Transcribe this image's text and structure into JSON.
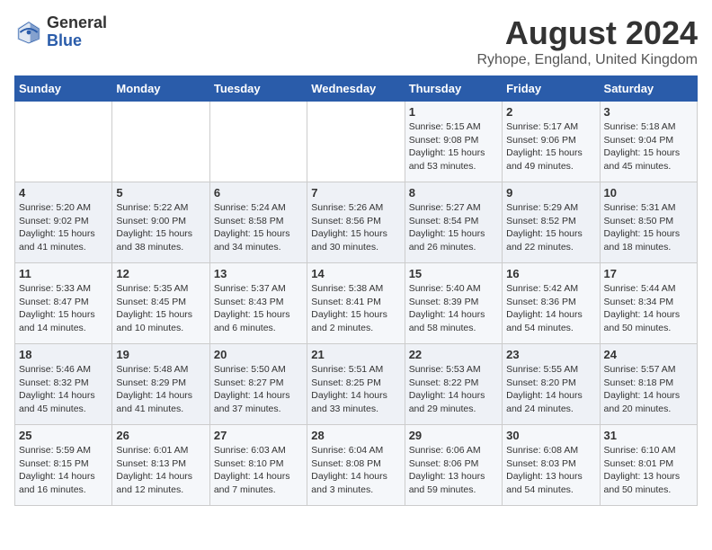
{
  "header": {
    "logo_line1": "General",
    "logo_line2": "Blue",
    "title": "August 2024",
    "subtitle": "Ryhope, England, United Kingdom"
  },
  "weekdays": [
    "Sunday",
    "Monday",
    "Tuesday",
    "Wednesday",
    "Thursday",
    "Friday",
    "Saturday"
  ],
  "weeks": [
    [
      {
        "day": "",
        "info": ""
      },
      {
        "day": "",
        "info": ""
      },
      {
        "day": "",
        "info": ""
      },
      {
        "day": "",
        "info": ""
      },
      {
        "day": "1",
        "info": "Sunrise: 5:15 AM\nSunset: 9:08 PM\nDaylight: 15 hours\nand 53 minutes."
      },
      {
        "day": "2",
        "info": "Sunrise: 5:17 AM\nSunset: 9:06 PM\nDaylight: 15 hours\nand 49 minutes."
      },
      {
        "day": "3",
        "info": "Sunrise: 5:18 AM\nSunset: 9:04 PM\nDaylight: 15 hours\nand 45 minutes."
      }
    ],
    [
      {
        "day": "4",
        "info": "Sunrise: 5:20 AM\nSunset: 9:02 PM\nDaylight: 15 hours\nand 41 minutes."
      },
      {
        "day": "5",
        "info": "Sunrise: 5:22 AM\nSunset: 9:00 PM\nDaylight: 15 hours\nand 38 minutes."
      },
      {
        "day": "6",
        "info": "Sunrise: 5:24 AM\nSunset: 8:58 PM\nDaylight: 15 hours\nand 34 minutes."
      },
      {
        "day": "7",
        "info": "Sunrise: 5:26 AM\nSunset: 8:56 PM\nDaylight: 15 hours\nand 30 minutes."
      },
      {
        "day": "8",
        "info": "Sunrise: 5:27 AM\nSunset: 8:54 PM\nDaylight: 15 hours\nand 26 minutes."
      },
      {
        "day": "9",
        "info": "Sunrise: 5:29 AM\nSunset: 8:52 PM\nDaylight: 15 hours\nand 22 minutes."
      },
      {
        "day": "10",
        "info": "Sunrise: 5:31 AM\nSunset: 8:50 PM\nDaylight: 15 hours\nand 18 minutes."
      }
    ],
    [
      {
        "day": "11",
        "info": "Sunrise: 5:33 AM\nSunset: 8:47 PM\nDaylight: 15 hours\nand 14 minutes."
      },
      {
        "day": "12",
        "info": "Sunrise: 5:35 AM\nSunset: 8:45 PM\nDaylight: 15 hours\nand 10 minutes."
      },
      {
        "day": "13",
        "info": "Sunrise: 5:37 AM\nSunset: 8:43 PM\nDaylight: 15 hours\nand 6 minutes."
      },
      {
        "day": "14",
        "info": "Sunrise: 5:38 AM\nSunset: 8:41 PM\nDaylight: 15 hours\nand 2 minutes."
      },
      {
        "day": "15",
        "info": "Sunrise: 5:40 AM\nSunset: 8:39 PM\nDaylight: 14 hours\nand 58 minutes."
      },
      {
        "day": "16",
        "info": "Sunrise: 5:42 AM\nSunset: 8:36 PM\nDaylight: 14 hours\nand 54 minutes."
      },
      {
        "day": "17",
        "info": "Sunrise: 5:44 AM\nSunset: 8:34 PM\nDaylight: 14 hours\nand 50 minutes."
      }
    ],
    [
      {
        "day": "18",
        "info": "Sunrise: 5:46 AM\nSunset: 8:32 PM\nDaylight: 14 hours\nand 45 minutes."
      },
      {
        "day": "19",
        "info": "Sunrise: 5:48 AM\nSunset: 8:29 PM\nDaylight: 14 hours\nand 41 minutes."
      },
      {
        "day": "20",
        "info": "Sunrise: 5:50 AM\nSunset: 8:27 PM\nDaylight: 14 hours\nand 37 minutes."
      },
      {
        "day": "21",
        "info": "Sunrise: 5:51 AM\nSunset: 8:25 PM\nDaylight: 14 hours\nand 33 minutes."
      },
      {
        "day": "22",
        "info": "Sunrise: 5:53 AM\nSunset: 8:22 PM\nDaylight: 14 hours\nand 29 minutes."
      },
      {
        "day": "23",
        "info": "Sunrise: 5:55 AM\nSunset: 8:20 PM\nDaylight: 14 hours\nand 24 minutes."
      },
      {
        "day": "24",
        "info": "Sunrise: 5:57 AM\nSunset: 8:18 PM\nDaylight: 14 hours\nand 20 minutes."
      }
    ],
    [
      {
        "day": "25",
        "info": "Sunrise: 5:59 AM\nSunset: 8:15 PM\nDaylight: 14 hours\nand 16 minutes."
      },
      {
        "day": "26",
        "info": "Sunrise: 6:01 AM\nSunset: 8:13 PM\nDaylight: 14 hours\nand 12 minutes."
      },
      {
        "day": "27",
        "info": "Sunrise: 6:03 AM\nSunset: 8:10 PM\nDaylight: 14 hours\nand 7 minutes."
      },
      {
        "day": "28",
        "info": "Sunrise: 6:04 AM\nSunset: 8:08 PM\nDaylight: 14 hours\nand 3 minutes."
      },
      {
        "day": "29",
        "info": "Sunrise: 6:06 AM\nSunset: 8:06 PM\nDaylight: 13 hours\nand 59 minutes."
      },
      {
        "day": "30",
        "info": "Sunrise: 6:08 AM\nSunset: 8:03 PM\nDaylight: 13 hours\nand 54 minutes."
      },
      {
        "day": "31",
        "info": "Sunrise: 6:10 AM\nSunset: 8:01 PM\nDaylight: 13 hours\nand 50 minutes."
      }
    ]
  ]
}
